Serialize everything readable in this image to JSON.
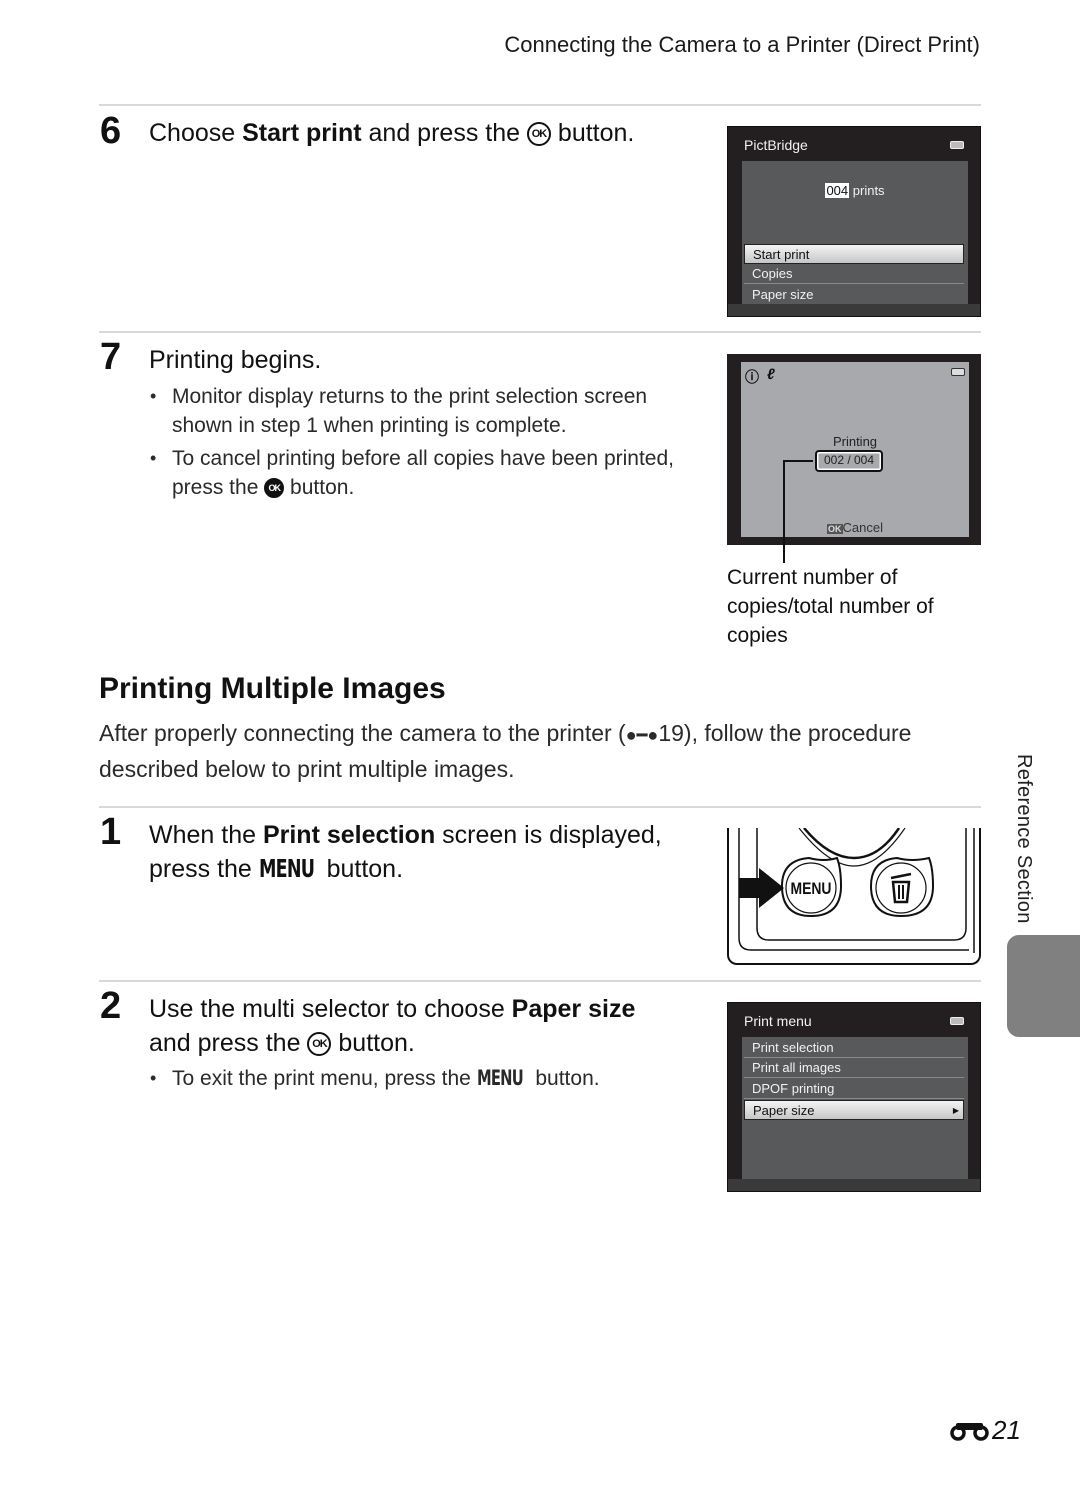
{
  "running_head": "Connecting the Camera to a Printer (Direct Print)",
  "step6": {
    "number": "6",
    "title_pre": "Choose ",
    "title_bold": "Start print",
    "title_mid": " and press the ",
    "title_post": " button.",
    "ok_glyph": "OK",
    "screen": {
      "title": "PictBridge",
      "count": "004",
      "count_suffix": "prints",
      "menu": [
        {
          "label": "Start print",
          "selected": true
        },
        {
          "label": "Copies",
          "selected": false
        },
        {
          "label": "Paper size",
          "selected": false
        }
      ]
    }
  },
  "step7": {
    "number": "7",
    "title": "Printing begins.",
    "bullets": [
      "Monitor display returns to the print selection screen shown in step 1 when printing is complete.",
      "To cancel printing before all copies have been printed,"
    ],
    "bullet2_line2_pre": "press the ",
    "bullet2_line2_post": " button.",
    "ok_glyph": "OK",
    "screen": {
      "status": "Printing",
      "counter": "002 / 004",
      "cancel_key": "OK",
      "cancel_label": "Cancel"
    },
    "caption": "Current number of copies/total number of copies"
  },
  "section": {
    "heading": "Printing Multiple Images",
    "intro_pre": "After properly connecting the camera to the printer (",
    "intro_ref": "19",
    "intro_post": "), follow the procedure described below to print multiple images."
  },
  "step1": {
    "number": "1",
    "title_pre": "When the ",
    "title_bold": "Print selection",
    "title_mid": " screen is displayed,",
    "title_line2_pre": "press the ",
    "menu_glyph": "MENU",
    "title_line2_post": " button.",
    "illustration": {
      "menu_button_label": "MENU"
    }
  },
  "step2": {
    "number": "2",
    "title_pre": "Use the multi selector to choose ",
    "title_bold": "Paper size",
    "title_line2_pre": "and press the ",
    "ok_glyph": "OK",
    "title_line2_post": " button.",
    "bullet_pre": "To exit the print menu, press the ",
    "menu_glyph": "MENU",
    "bullet_post": " button.",
    "screen": {
      "title": "Print menu",
      "menu": [
        {
          "label": "Print selection",
          "selected": false
        },
        {
          "label": "Print all images",
          "selected": false
        },
        {
          "label": "DPOF printing",
          "selected": false
        },
        {
          "label": "Paper size",
          "selected": true
        }
      ]
    }
  },
  "side_label": "Reference Section",
  "page_number": "21"
}
